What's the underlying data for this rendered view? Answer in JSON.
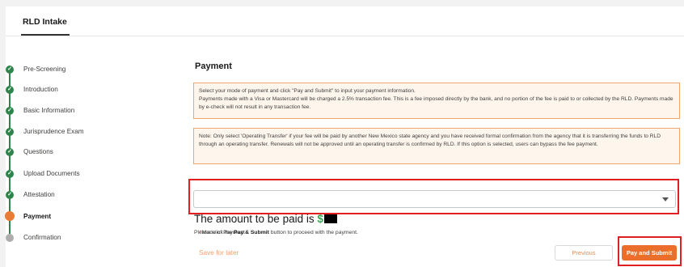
{
  "tab": {
    "label": "RLD Intake"
  },
  "steps": [
    {
      "label": "Pre-Screening",
      "status": "complete"
    },
    {
      "label": "Introduction",
      "status": "complete"
    },
    {
      "label": "Basic Information",
      "status": "complete"
    },
    {
      "label": "Jurisprudence Exam",
      "status": "complete"
    },
    {
      "label": "Questions",
      "status": "complete"
    },
    {
      "label": "Upload Documents",
      "status": "complete"
    },
    {
      "label": "Attestation",
      "status": "complete"
    },
    {
      "label": "Payment",
      "status": "current"
    },
    {
      "label": "Confirmation",
      "status": "pending"
    }
  ],
  "step_check_glyph": "✓",
  "page_title": "Payment",
  "notice1": {
    "line1": "Select your mode of payment and click \"Pay and Submit\" to input your payment information.",
    "line2": "Payments made with a Visa or Mastercard will be charged a 2.5% transaction fee. This is a fee imposed directly by the bank, and no portion of the fee is paid to or collected by the RLD. Payments made by e-check will not result in any transaction fee."
  },
  "notice2": {
    "text": "Note: Only select 'Operating Transfer' if your fee will be paid by another New Mexico state agency and you have received formal confirmation from the agency that it is transferring the funds to RLD through an operating transfer. Renewals will not be approved until an operating transfer is confirmed by RLD. If this option is selected, users can bypass the fee payment."
  },
  "mode_of_payment": {
    "required_marker": "*",
    "label": "Mode of Payment",
    "value": ""
  },
  "amount": {
    "text": "The amount to be paid is",
    "currency": "$"
  },
  "instruction": {
    "before": "Please click the",
    "bold": "Pay & Submit",
    "after": "button to proceed with the payment."
  },
  "actions": {
    "save_later": "Save for later",
    "previous": "Previous",
    "pay_submit": "Pay and Submit"
  },
  "colors": {
    "complete": "#2e844a",
    "current": "#ea7b34",
    "pending": "#adadad",
    "accent": "#ea6f2c",
    "highlight_box": "#e02020"
  }
}
